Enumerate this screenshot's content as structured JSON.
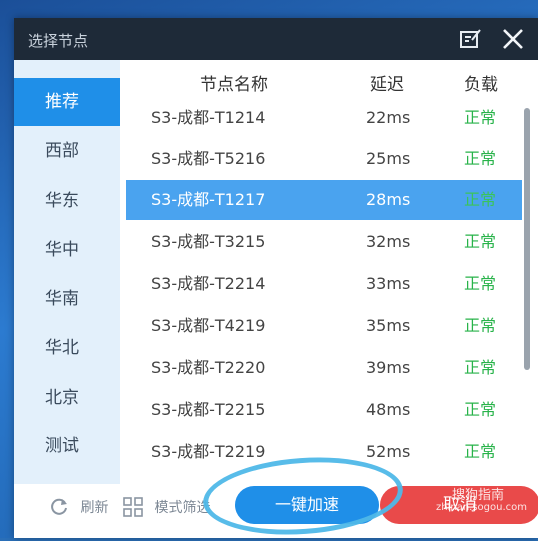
{
  "window": {
    "title": "选择节点"
  },
  "sidebar": {
    "items": [
      {
        "label": "推荐",
        "active": true
      },
      {
        "label": "西部"
      },
      {
        "label": "华东"
      },
      {
        "label": "华中"
      },
      {
        "label": "华南"
      },
      {
        "label": "华北"
      },
      {
        "label": "北京"
      },
      {
        "label": "测试"
      }
    ]
  },
  "table": {
    "columns": {
      "name": "节点名称",
      "delay": "延迟",
      "load": "负载"
    },
    "rows": [
      {
        "name": "S3-成都-T1214",
        "delay": "22ms",
        "load": "正常"
      },
      {
        "name": "S3-成都-T5216",
        "delay": "25ms",
        "load": "正常"
      },
      {
        "name": "S3-成都-T1217",
        "delay": "28ms",
        "load": "正常",
        "selected": true
      },
      {
        "name": "S3-成都-T3215",
        "delay": "32ms",
        "load": "正常"
      },
      {
        "name": "S3-成都-T2214",
        "delay": "33ms",
        "load": "正常"
      },
      {
        "name": "S3-成都-T4219",
        "delay": "35ms",
        "load": "正常"
      },
      {
        "name": "S3-成都-T2220",
        "delay": "39ms",
        "load": "正常"
      },
      {
        "name": "S3-成都-T2215",
        "delay": "48ms",
        "load": "正常"
      },
      {
        "name": "S3-成都-T2219",
        "delay": "52ms",
        "load": "正常"
      }
    ]
  },
  "footer": {
    "refresh_label": "刷新",
    "mode_label": "模式筛选",
    "speed_button": "一键加速",
    "cancel_button": "取消"
  },
  "watermark": {
    "main": "搜狗指南",
    "sub": "zhinan.sogou.com"
  },
  "colors": {
    "accent": "#1f8fe8",
    "selected_row": "#4aa3ef",
    "status_ok": "#28b34a",
    "cancel": "#e94a4a",
    "titlebar": "#1e2a38"
  },
  "icons": [
    "edit-icon",
    "close-icon",
    "refresh-icon",
    "grid-icon"
  ]
}
